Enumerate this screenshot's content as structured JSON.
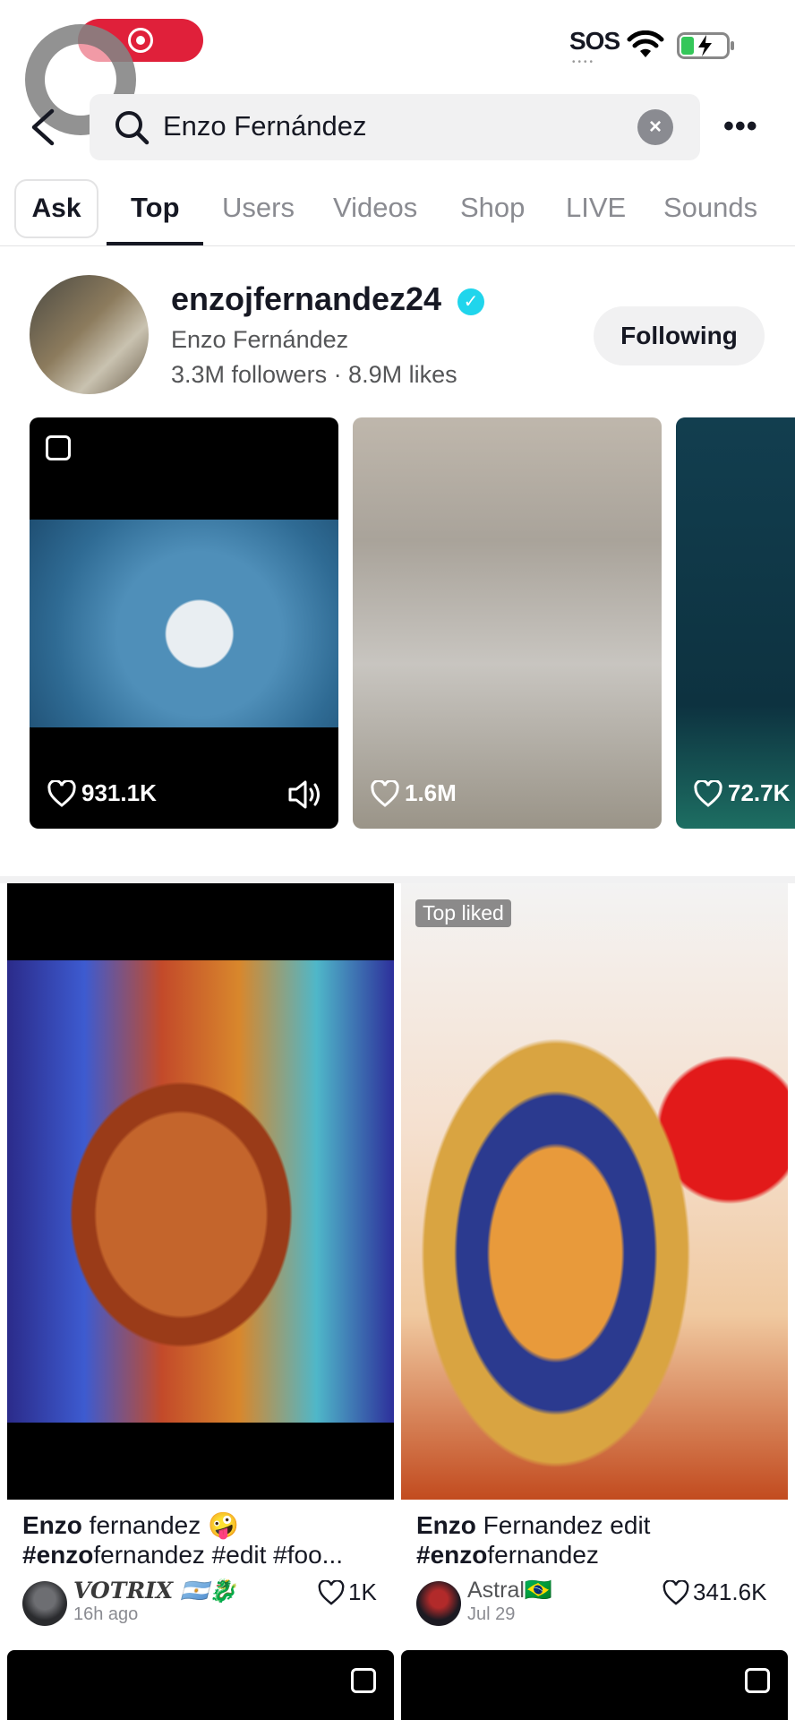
{
  "status_bar": {
    "sos": "SOS",
    "sos_dots": "••••"
  },
  "search": {
    "query": "Enzo Fernández",
    "back_icon": "chevron-left-icon",
    "clear_icon": "×",
    "more": "•••"
  },
  "tabs": [
    {
      "label": "Ask"
    },
    {
      "label": "Top",
      "active": true
    },
    {
      "label": "Users"
    },
    {
      "label": "Videos"
    },
    {
      "label": "Shop"
    },
    {
      "label": "LIVE"
    },
    {
      "label": "Sounds"
    }
  ],
  "user_card": {
    "username": "enzojfernandez24",
    "verified_mark": "✓",
    "display_name": "Enzo Fernández",
    "stats": "3.3M followers · 8.9M likes",
    "follow_label": "Following"
  },
  "user_videos": [
    {
      "likes": "931.1K"
    },
    {
      "likes": "1.6M"
    },
    {
      "likes": "72.7K"
    }
  ],
  "results": [
    {
      "title_bold": "Enzo",
      "title_rest": " fernandez 🤪",
      "tags_bold": "#enzo",
      "tags_rest": "fernandez #edit #foo...",
      "author": "VOTRIX 🇦🇷🐉",
      "time": "16h ago",
      "likes": "1K"
    },
    {
      "badge": "Top liked",
      "title_bold": "Enzo",
      "title_rest": " Fernandez edit",
      "tags_bold": "#enzo",
      "tags_rest": "fernandez",
      "author": "Astral🇧🇷",
      "time": "Jul 29",
      "likes": "341.6K"
    }
  ],
  "colors": {
    "accent_red": "#e0203a",
    "verified": "#20d5ec",
    "text": "#161823",
    "muted": "#8a8b91"
  }
}
